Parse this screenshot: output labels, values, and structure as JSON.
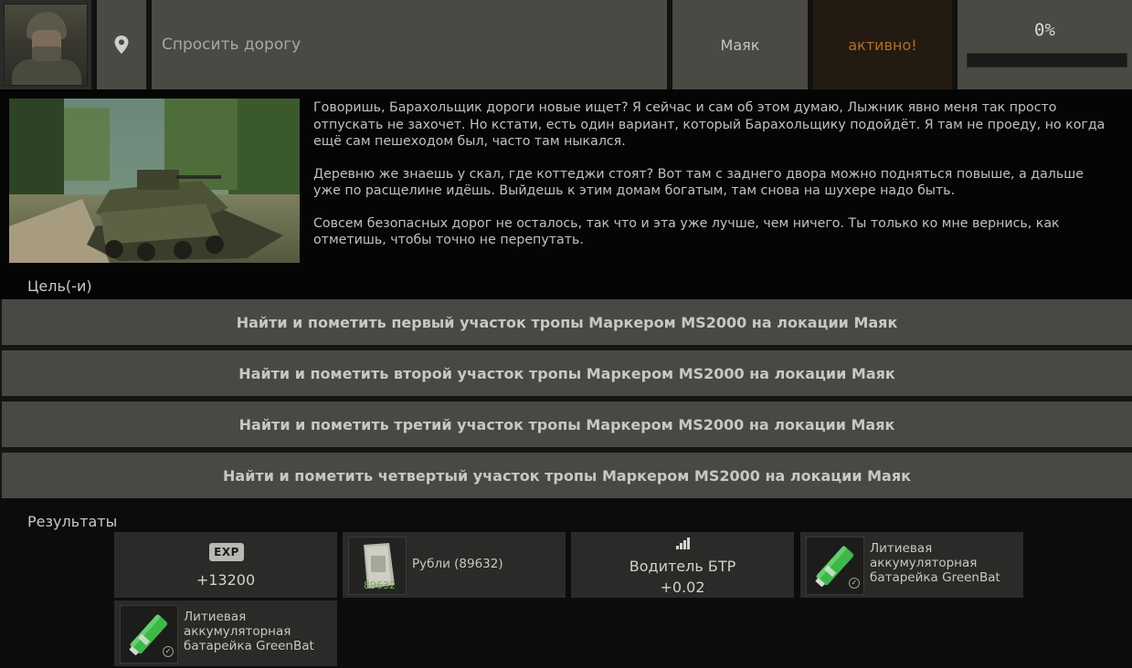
{
  "header": {
    "ask_label": "Спросить дорогу",
    "map": "Маяк",
    "status": "активно!",
    "progress_text": "0%",
    "progress_fraction": 0.0,
    "icons": {
      "location": "location-pin-icon"
    }
  },
  "description": {
    "paragraphs": [
      "Говоришь, Барахольщик дороги новые ищет? Я сейчас и сам об этом думаю, Лыжник явно меня так просто отпускать не захочет. Но кстати, есть один вариант, который Барахольщику подойдёт. Я там не проеду, но когда ещё сам пешеходом был, часто там ныкался.",
      "Деревню же знаешь у скал, где коттеджи стоят? Вот там с заднего двора можно подняться повыше, а дальше уже по расщелине идёшь. Выйдешь к этим домам богатым, там снова на шухере надо быть.",
      "Совсем безопасных дорог не осталось, так что и эта уже лучше, чем ничего. Ты только ко мне вернись, как отметишь, чтобы точно не перепутать."
    ]
  },
  "objectives": {
    "title": "Цель(-и)",
    "items": [
      "Найти и пометить первый участок тропы Маркером MS2000 на локации Маяк",
      "Найти и пометить второй участок тропы Маркером MS2000 на локации Маяк",
      "Найти и пометить третий участок тропы Маркером MS2000 на локации Маяк",
      "Найти и пометить четвертый участок тропы Маркером MS2000 на локации Маяк"
    ]
  },
  "rewards": {
    "title": "Результаты",
    "exp": {
      "badge": "EXP",
      "value": "+13200"
    },
    "money": {
      "label": "Рубли (89632)",
      "count": "89632"
    },
    "skill": {
      "name": "Водитель БТР",
      "value": "+0.02"
    },
    "battery_1": {
      "name_lines": [
        "Литиевая",
        "аккумуляторная",
        "батарейка GreenBat"
      ]
    },
    "battery_2": {
      "name_lines": [
        "Литиевая",
        "аккумуляторная",
        "батарейка GreenBat"
      ]
    },
    "colors": {
      "battery": "#3fb84a",
      "status": "#b46d29"
    }
  }
}
